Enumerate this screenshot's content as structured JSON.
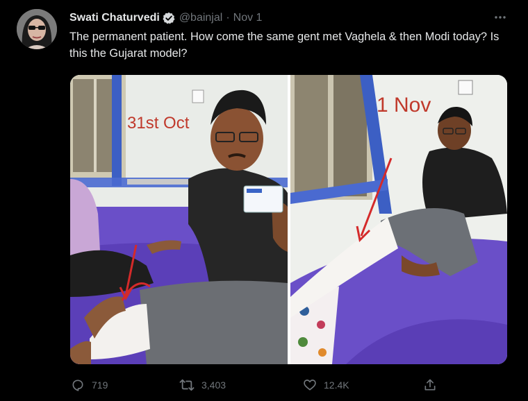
{
  "tweet": {
    "author_name": "Swati Chaturvedi",
    "handle": "@bainjal",
    "separator": "·",
    "date": "Nov 1",
    "text": "The permanent patient. How come the same gent met Vaghela & then Modi today? Is this the Gujarat model?"
  },
  "media": {
    "left_label": "31st Oct",
    "right_label": "1 Nov"
  },
  "actions": {
    "replies": "719",
    "retweets": "3,403",
    "likes": "12.4K"
  },
  "icons": {
    "verified": "verified-badge-icon",
    "more": "more-dots-icon",
    "reply": "reply-icon",
    "retweet": "retweet-icon",
    "like": "heart-icon",
    "share": "share-icon"
  },
  "colors": {
    "background": "#000000",
    "text": "#e7e9ea",
    "muted": "#71767b",
    "annotation_red": "#d42a2a",
    "bed_purple": "#6a4fc8"
  }
}
